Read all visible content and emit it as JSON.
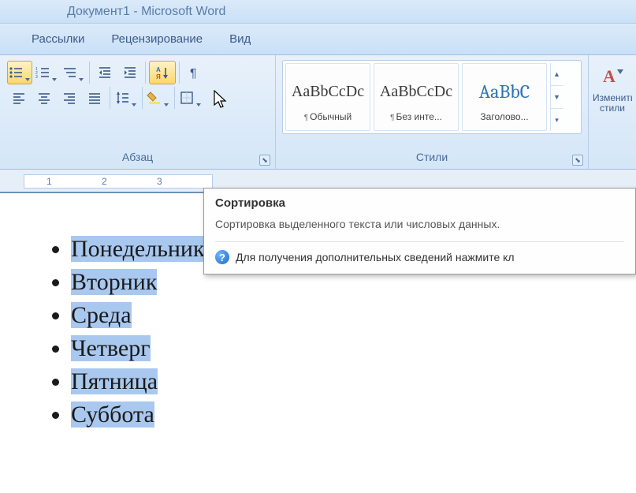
{
  "title": "Документ1 - Microsoft Word",
  "tabs": {
    "mailings": "Рассылки",
    "review": "Рецензирование",
    "view": "Вид"
  },
  "groups": {
    "paragraph": "Абзац",
    "styles": "Стили"
  },
  "styles": {
    "sample": "AaBbCcDc",
    "sample_heading": "AaBbC",
    "normal": "Обычный",
    "no_spacing": "Без инте...",
    "heading": "Заголово...",
    "change_styles": "Изменить стили"
  },
  "ruler": {
    "n1": "1",
    "n2": "2",
    "n3": "3"
  },
  "tooltip": {
    "title": "Сортировка",
    "desc": "Сортировка выделенного текста или числовых данных.",
    "help": "Для получения дополнительных сведений нажмите кл"
  },
  "list": {
    "items": [
      "Понедельник",
      "Вторник",
      "Среда",
      "Четверг",
      "Пятница",
      "Суббота"
    ]
  }
}
